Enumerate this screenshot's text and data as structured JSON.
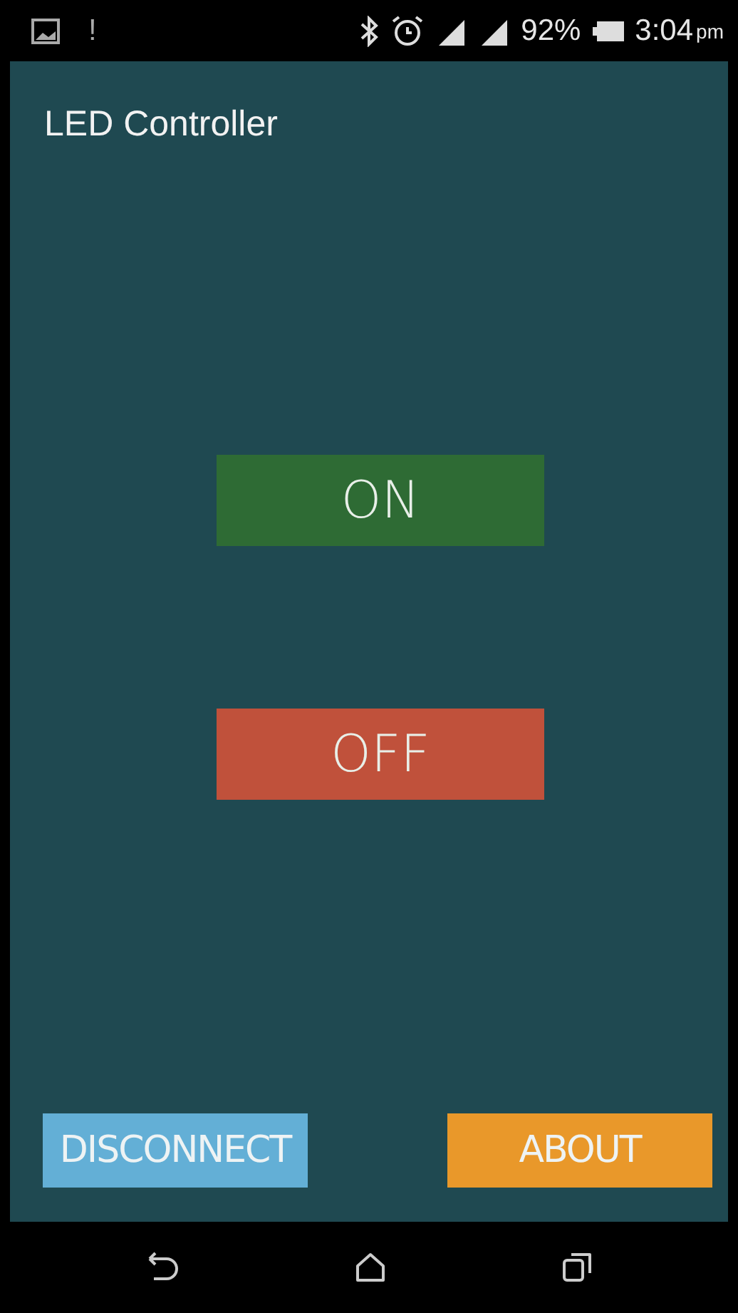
{
  "status_bar": {
    "alert": "!",
    "battery": "92%",
    "time": "3:04",
    "period": "pm"
  },
  "app_bar": {
    "title": "LED Controller"
  },
  "main_buttons": [
    {
      "label": "ON",
      "color": "#2e6b34"
    },
    {
      "label": "OFF",
      "color": "#c0513b"
    }
  ],
  "footer_buttons": [
    {
      "label": "DISCONNECT",
      "color": "#63afd6"
    },
    {
      "label": "ABOUT",
      "color": "#e9982a"
    }
  ]
}
